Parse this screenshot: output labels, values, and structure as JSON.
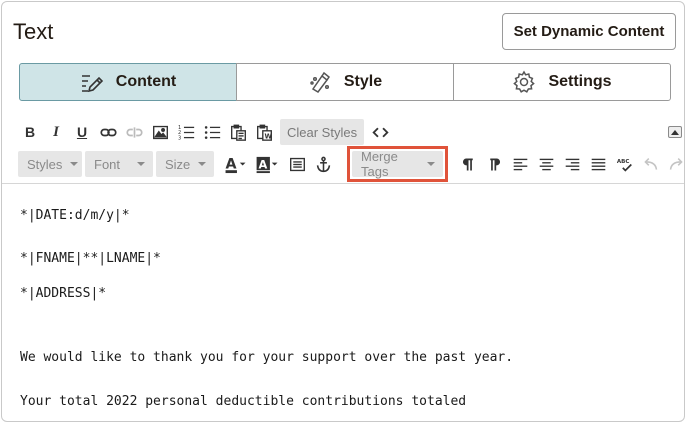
{
  "panel": {
    "title": "Text",
    "dynamic_button_label": "Set Dynamic Content"
  },
  "tabs": [
    {
      "label": "Content",
      "icon": "edit-lines-icon",
      "active": true
    },
    {
      "label": "Style",
      "icon": "paint-drops-icon",
      "active": false
    },
    {
      "label": "Settings",
      "icon": "gear-icon",
      "active": false
    }
  ],
  "toolbar": {
    "bold": "B",
    "italic": "I",
    "underline": "U",
    "clear_styles": "Clear Styles",
    "styles": "Styles",
    "font": "Font",
    "size": "Size",
    "merge_tags": "Merge Tags",
    "spellcheck": "ABC"
  },
  "editor": {
    "lines": [
      "*|DATE:d/m/y|*",
      "*|FNAME|**|LNAME|*",
      "*|ADDRESS|*",
      "We would like to thank you for your support over the past year.",
      "Your total 2022 personal deductible contributions totaled"
    ]
  },
  "colors": {
    "active_tab": "#cfe4e7",
    "highlight": "#e0533a"
  }
}
